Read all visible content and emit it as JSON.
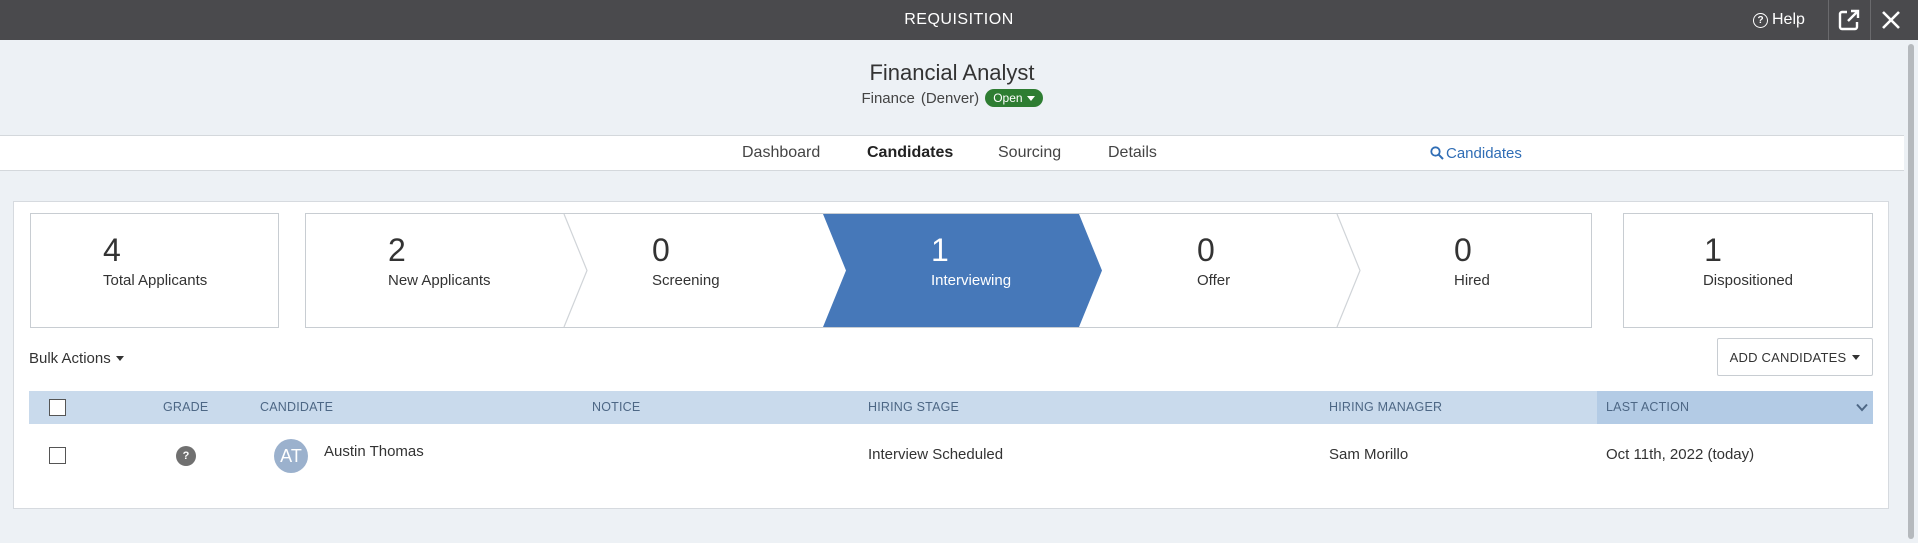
{
  "topbar": {
    "title": "REQUISITION",
    "help_label": "Help"
  },
  "requisition": {
    "title": "Financial Analyst",
    "department": "Finance",
    "location": "(Denver)",
    "status": "Open"
  },
  "nav": {
    "tabs": [
      "Dashboard",
      "Candidates",
      "Sourcing",
      "Details"
    ],
    "active_tab": "Candidates",
    "search_label": "Candidates"
  },
  "summary": {
    "total": {
      "count": "4",
      "label": "Total Applicants"
    },
    "stages": [
      {
        "count": "2",
        "label": "New Applicants"
      },
      {
        "count": "0",
        "label": "Screening"
      },
      {
        "count": "1",
        "label": "Interviewing"
      },
      {
        "count": "0",
        "label": "Offer"
      },
      {
        "count": "0",
        "label": "Hired"
      }
    ],
    "active_stage": "Interviewing",
    "dispositioned": {
      "count": "1",
      "label": "Dispositioned"
    }
  },
  "toolbar": {
    "bulk_actions": "Bulk Actions",
    "add_candidates": "ADD CANDIDATES"
  },
  "table": {
    "columns": [
      "GRADE",
      "CANDIDATE",
      "NOTICE",
      "HIRING STAGE",
      "HIRING MANAGER",
      "LAST ACTION"
    ],
    "sorted_column": "LAST ACTION",
    "rows": [
      {
        "grade": "?",
        "initials": "AT",
        "candidate": "Austin Thomas",
        "notice": "",
        "hiring_stage": "Interview Scheduled",
        "hiring_manager": "Sam Morillo",
        "last_action": "Oct 11th, 2022 (today)"
      }
    ]
  },
  "colors": {
    "topbar": "#4a4a4d",
    "accent": "#4678b9",
    "status_open": "#2e7d32",
    "link": "#2f6db5",
    "table_header": "#c9daec"
  }
}
